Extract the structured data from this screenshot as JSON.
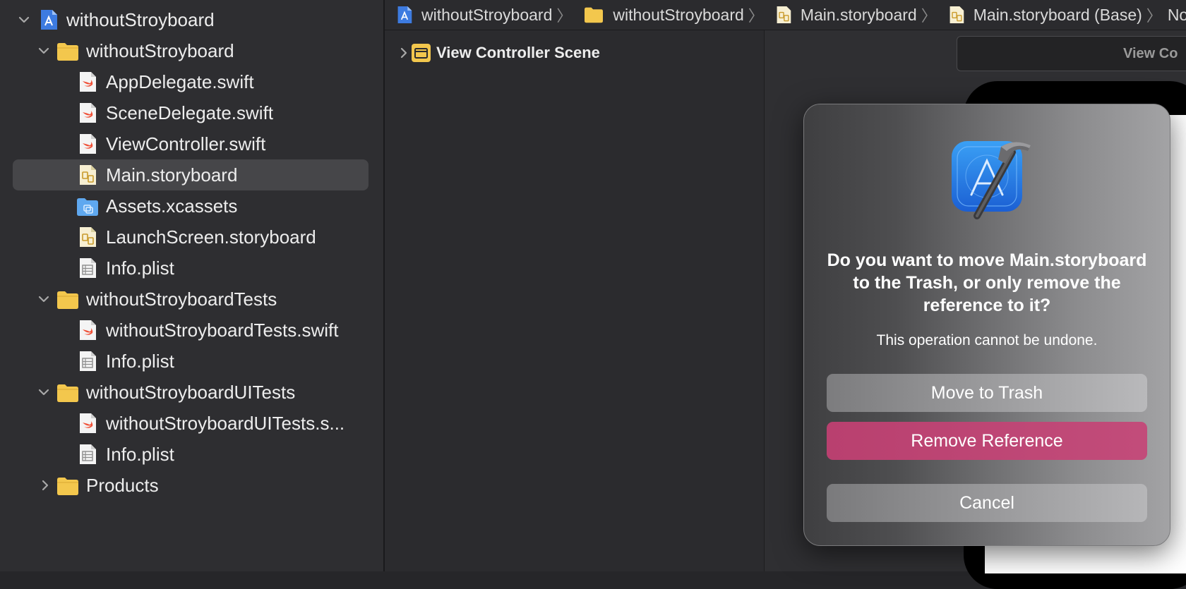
{
  "navigator": {
    "items": [
      {
        "label": "withoutStroyboard",
        "type": "project",
        "expanded": true
      },
      {
        "label": "withoutStroyboard",
        "type": "folder",
        "expanded": true
      },
      {
        "label": "AppDelegate.swift",
        "type": "swift"
      },
      {
        "label": "SceneDelegate.swift",
        "type": "swift"
      },
      {
        "label": "ViewController.swift",
        "type": "swift"
      },
      {
        "label": "Main.storyboard",
        "type": "storyboard",
        "selected": true
      },
      {
        "label": "Assets.xcassets",
        "type": "assets"
      },
      {
        "label": "LaunchScreen.storyboard",
        "type": "storyboard"
      },
      {
        "label": "Info.plist",
        "type": "plist"
      },
      {
        "label": "withoutStroyboardTests",
        "type": "folder",
        "expanded": true
      },
      {
        "label": "withoutStroyboardTests.swift",
        "type": "swift"
      },
      {
        "label": "Info.plist",
        "type": "plist"
      },
      {
        "label": "withoutStroyboardUITests",
        "type": "folder",
        "expanded": true
      },
      {
        "label": "withoutStroyboardUITests.s...",
        "type": "swift"
      },
      {
        "label": "Info.plist",
        "type": "plist"
      },
      {
        "label": "Products",
        "type": "folder",
        "expanded": false
      }
    ]
  },
  "breadcrumb": {
    "items": [
      {
        "label": "withoutStroyboard",
        "icon": "project-icon"
      },
      {
        "label": "withoutStroyboard",
        "icon": "folder-icon"
      },
      {
        "label": "Main.storyboard",
        "icon": "storyboard-icon"
      },
      {
        "label": "Main.storyboard (Base)",
        "icon": "storyboard-icon"
      },
      {
        "label": "No Se",
        "icon": ""
      }
    ]
  },
  "outline": {
    "scene_label": "View Controller Scene"
  },
  "canvas": {
    "scene_bar_label": "View Co"
  },
  "dialog": {
    "title": "Do you want to move Main.storyboard to the Trash, or only remove the reference to it?",
    "message": "This operation cannot be undone.",
    "move_to_trash_label": "Move to Trash",
    "remove_reference_label": "Remove Reference",
    "cancel_label": "Cancel"
  },
  "colors": {
    "accent_button": "#c24c7a",
    "selection": "#464649",
    "folder": "#f3c74d",
    "swift": "#f05138"
  }
}
